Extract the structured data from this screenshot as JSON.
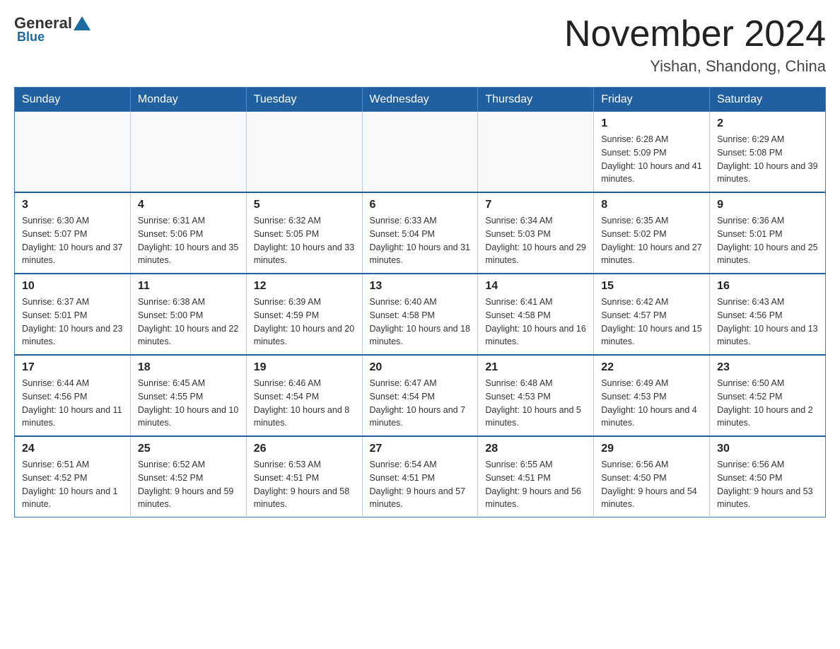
{
  "header": {
    "logo": {
      "general": "General",
      "blue": "Blue"
    },
    "title": "November 2024",
    "location": "Yishan, Shandong, China"
  },
  "weekdays": [
    "Sunday",
    "Monday",
    "Tuesday",
    "Wednesday",
    "Thursday",
    "Friday",
    "Saturday"
  ],
  "weeks": [
    [
      {
        "day": "",
        "info": ""
      },
      {
        "day": "",
        "info": ""
      },
      {
        "day": "",
        "info": ""
      },
      {
        "day": "",
        "info": ""
      },
      {
        "day": "",
        "info": ""
      },
      {
        "day": "1",
        "info": "Sunrise: 6:28 AM\nSunset: 5:09 PM\nDaylight: 10 hours and 41 minutes."
      },
      {
        "day": "2",
        "info": "Sunrise: 6:29 AM\nSunset: 5:08 PM\nDaylight: 10 hours and 39 minutes."
      }
    ],
    [
      {
        "day": "3",
        "info": "Sunrise: 6:30 AM\nSunset: 5:07 PM\nDaylight: 10 hours and 37 minutes."
      },
      {
        "day": "4",
        "info": "Sunrise: 6:31 AM\nSunset: 5:06 PM\nDaylight: 10 hours and 35 minutes."
      },
      {
        "day": "5",
        "info": "Sunrise: 6:32 AM\nSunset: 5:05 PM\nDaylight: 10 hours and 33 minutes."
      },
      {
        "day": "6",
        "info": "Sunrise: 6:33 AM\nSunset: 5:04 PM\nDaylight: 10 hours and 31 minutes."
      },
      {
        "day": "7",
        "info": "Sunrise: 6:34 AM\nSunset: 5:03 PM\nDaylight: 10 hours and 29 minutes."
      },
      {
        "day": "8",
        "info": "Sunrise: 6:35 AM\nSunset: 5:02 PM\nDaylight: 10 hours and 27 minutes."
      },
      {
        "day": "9",
        "info": "Sunrise: 6:36 AM\nSunset: 5:01 PM\nDaylight: 10 hours and 25 minutes."
      }
    ],
    [
      {
        "day": "10",
        "info": "Sunrise: 6:37 AM\nSunset: 5:01 PM\nDaylight: 10 hours and 23 minutes."
      },
      {
        "day": "11",
        "info": "Sunrise: 6:38 AM\nSunset: 5:00 PM\nDaylight: 10 hours and 22 minutes."
      },
      {
        "day": "12",
        "info": "Sunrise: 6:39 AM\nSunset: 4:59 PM\nDaylight: 10 hours and 20 minutes."
      },
      {
        "day": "13",
        "info": "Sunrise: 6:40 AM\nSunset: 4:58 PM\nDaylight: 10 hours and 18 minutes."
      },
      {
        "day": "14",
        "info": "Sunrise: 6:41 AM\nSunset: 4:58 PM\nDaylight: 10 hours and 16 minutes."
      },
      {
        "day": "15",
        "info": "Sunrise: 6:42 AM\nSunset: 4:57 PM\nDaylight: 10 hours and 15 minutes."
      },
      {
        "day": "16",
        "info": "Sunrise: 6:43 AM\nSunset: 4:56 PM\nDaylight: 10 hours and 13 minutes."
      }
    ],
    [
      {
        "day": "17",
        "info": "Sunrise: 6:44 AM\nSunset: 4:56 PM\nDaylight: 10 hours and 11 minutes."
      },
      {
        "day": "18",
        "info": "Sunrise: 6:45 AM\nSunset: 4:55 PM\nDaylight: 10 hours and 10 minutes."
      },
      {
        "day": "19",
        "info": "Sunrise: 6:46 AM\nSunset: 4:54 PM\nDaylight: 10 hours and 8 minutes."
      },
      {
        "day": "20",
        "info": "Sunrise: 6:47 AM\nSunset: 4:54 PM\nDaylight: 10 hours and 7 minutes."
      },
      {
        "day": "21",
        "info": "Sunrise: 6:48 AM\nSunset: 4:53 PM\nDaylight: 10 hours and 5 minutes."
      },
      {
        "day": "22",
        "info": "Sunrise: 6:49 AM\nSunset: 4:53 PM\nDaylight: 10 hours and 4 minutes."
      },
      {
        "day": "23",
        "info": "Sunrise: 6:50 AM\nSunset: 4:52 PM\nDaylight: 10 hours and 2 minutes."
      }
    ],
    [
      {
        "day": "24",
        "info": "Sunrise: 6:51 AM\nSunset: 4:52 PM\nDaylight: 10 hours and 1 minute."
      },
      {
        "day": "25",
        "info": "Sunrise: 6:52 AM\nSunset: 4:52 PM\nDaylight: 9 hours and 59 minutes."
      },
      {
        "day": "26",
        "info": "Sunrise: 6:53 AM\nSunset: 4:51 PM\nDaylight: 9 hours and 58 minutes."
      },
      {
        "day": "27",
        "info": "Sunrise: 6:54 AM\nSunset: 4:51 PM\nDaylight: 9 hours and 57 minutes."
      },
      {
        "day": "28",
        "info": "Sunrise: 6:55 AM\nSunset: 4:51 PM\nDaylight: 9 hours and 56 minutes."
      },
      {
        "day": "29",
        "info": "Sunrise: 6:56 AM\nSunset: 4:50 PM\nDaylight: 9 hours and 54 minutes."
      },
      {
        "day": "30",
        "info": "Sunrise: 6:56 AM\nSunset: 4:50 PM\nDaylight: 9 hours and 53 minutes."
      }
    ]
  ]
}
